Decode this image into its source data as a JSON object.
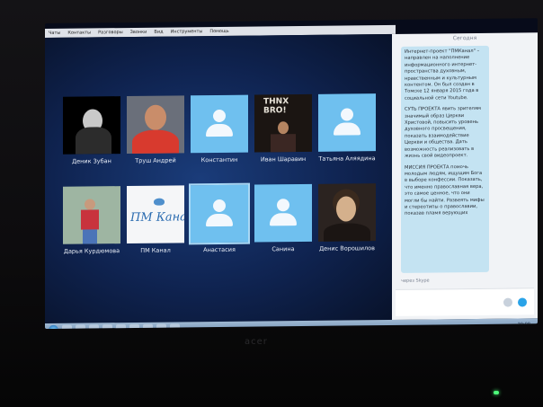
{
  "menu": [
    "Чаты",
    "Контакты",
    "Разговоры",
    "Звонки",
    "Вид",
    "Инструменты",
    "Помощь"
  ],
  "contacts": {
    "tiles": [
      {
        "name": "Деник Зубан",
        "photo": "photo-zuban"
      },
      {
        "name": "Труш Андрей",
        "photo": "photo-trush"
      },
      {
        "name": "Константин",
        "photo": "default-avatar"
      },
      {
        "name": "Иван Шаравин",
        "photo": "photo-ivan"
      },
      {
        "name": "Татьяна Аляядина",
        "photo": "default-avatar"
      },
      {
        "name": "Дарья Курдюмова",
        "photo": "photo-darya"
      },
      {
        "name": "ПМ Канал",
        "photo": "photo-pm"
      },
      {
        "name": "Анастасия",
        "photo": "default-avatar"
      },
      {
        "name": "Санина",
        "photo": "default-avatar"
      },
      {
        "name": "Денис Ворошилов",
        "photo": "photo-denis"
      }
    ],
    "photo_text": {
      "ivan": "THNX BRO!",
      "pm": "ПМ Канал"
    }
  },
  "chat": {
    "date": "Сегодня",
    "paragraphs": [
      "Интернет-проект \"ПМКанал\" – направлен на наполнение информационного интернет-пространства духовным, нравственным и культурным контентом. Он был создан в Томске 12 января 2015 года в социальной сети Youtube.",
      "СУТЬ ПРОЕКТА явить зрителям значимый образ Церкви Христовой, повысить уровень духовного просвещения, показать взаимодействие Церкви и общества. Дать возможность реализовать в жизнь свой видеопроект.",
      "МИССИЯ ПРОЕКТА помочь молодым людям, ищущим Бога в выборе конфессии. Показать, что именно православная вера, это самое ценное, что они могли бы найти. Развеять мифы и стереотипы о православии, показав пламя верующих"
    ],
    "status": "через Skype",
    "composer_value": ""
  },
  "taskbar": {
    "clock": "20:08"
  },
  "hardware": {
    "brand": "acer"
  },
  "colors": {
    "default_avatar": "#6fc0ef",
    "bubble": "#c4e3f2",
    "send": "#2aa3e8"
  }
}
